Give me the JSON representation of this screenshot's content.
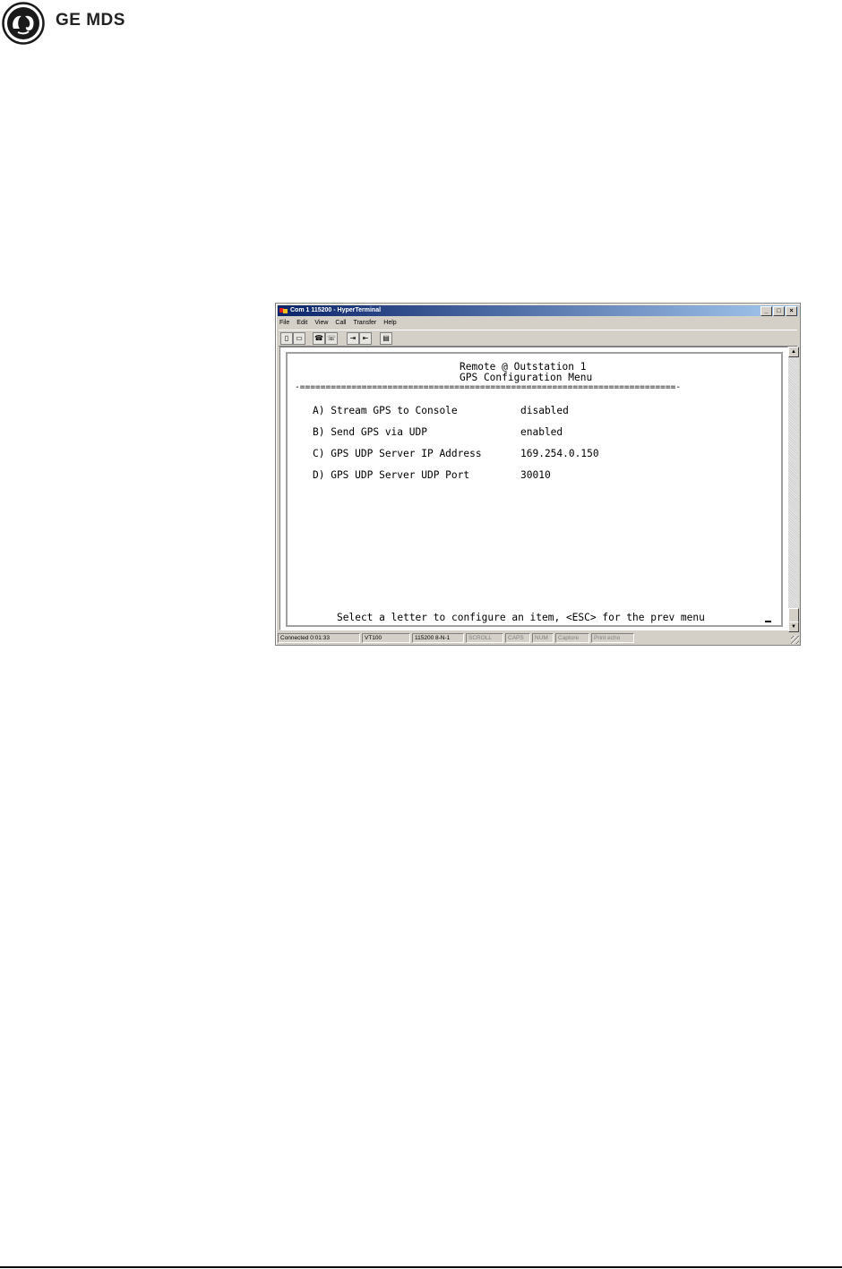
{
  "brand": {
    "name": "GE MDS"
  },
  "window": {
    "title": "Com 1 115200 - HyperTerminal",
    "menu": [
      "File",
      "Edit",
      "View",
      "Call",
      "Transfer",
      "Help"
    ],
    "toolbar_icons": [
      "new-icon",
      "open-icon",
      "connect-icon",
      "disconnect-icon",
      "send-icon",
      "receive-icon",
      "properties-icon"
    ]
  },
  "terminal": {
    "header1": "Remote @ Outstation 1",
    "header2": "GPS Configuration Menu",
    "rule": "-=========================================================================-",
    "items": [
      {
        "label": "A) Stream GPS to Console",
        "value": "disabled"
      },
      {
        "label": "B) Send GPS via UDP",
        "value": "enabled"
      },
      {
        "label": "C) GPS UDP Server IP Address",
        "value": "169.254.0.150"
      },
      {
        "label": "D) GPS UDP Server UDP Port",
        "value": "30010"
      }
    ],
    "prompt": "Select a letter to configure an item, <ESC> for the prev menu"
  },
  "statusbar": {
    "connected": "Connected 0:01:33",
    "emulation": "VT100",
    "settings": "115200 8-N-1",
    "scroll": "SCROLL",
    "caps": "CAPS",
    "num": "NUM",
    "capture": "Capture",
    "printecho": "Print echo"
  }
}
